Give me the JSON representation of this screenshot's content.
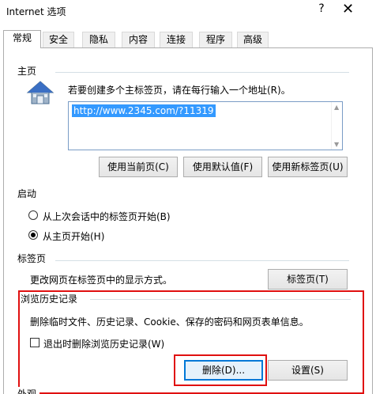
{
  "window": {
    "title": "Internet 选项",
    "help_glyph": "?",
    "close_glyph": "✕"
  },
  "tabs": [
    {
      "label": "常规",
      "active": true
    },
    {
      "label": "安全"
    },
    {
      "label": "隐私"
    },
    {
      "label": "内容"
    },
    {
      "label": "连接"
    },
    {
      "label": "程序"
    },
    {
      "label": "高级"
    }
  ],
  "homepage": {
    "label": "主页",
    "description": "若要创建多个主标签页，请在每行输入一个地址(R)。",
    "url": "http://www.2345.com/?11319",
    "buttons": {
      "use_current": "使用当前页(C)",
      "use_default": "使用默认值(F)",
      "use_new_tab": "使用新标签页(U)"
    }
  },
  "startup": {
    "label": "启动",
    "options": [
      {
        "label": "从上次会话中的标签页开始(B)",
        "checked": false
      },
      {
        "label": "从主页开始(H)",
        "checked": true
      }
    ]
  },
  "tabs_section": {
    "label": "标签页",
    "description": "更改网页在标签页中的显示方式。",
    "button": "标签页(T)"
  },
  "history": {
    "label": "浏览历史记录",
    "description": "删除临时文件、历史记录、Cookie、保存的密码和网页表单信息。",
    "checkbox_label": "退出时删除浏览历史记录(W)",
    "checkbox_checked": false,
    "delete_button": "删除(D)...",
    "settings_button": "设置(S)"
  },
  "appearance": {
    "label": "外观"
  },
  "colors": {
    "highlight": "#e01010",
    "selection": "#3399ff",
    "focus": "#0078d7"
  }
}
